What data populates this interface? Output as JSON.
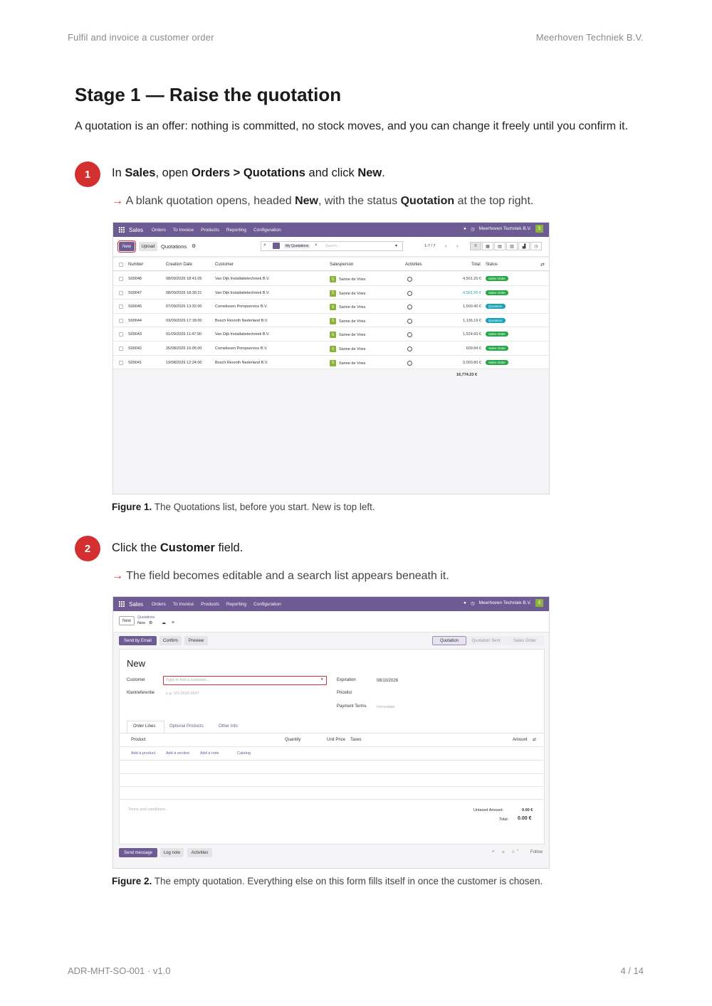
{
  "header": {
    "left": "Fulfil and invoice a customer order",
    "right": "Meerhoven Techniek B.V."
  },
  "title": "Stage 1 — Raise the quotation",
  "intro": "A quotation is an offer: nothing is committed, no stock moves, and you can change it freely until you confirm it.",
  "steps": [
    {
      "number": "1",
      "text_parts": [
        "In ",
        "Sales",
        ", open ",
        "Orders > Quotations",
        " and click ",
        "New",
        "."
      ],
      "result_parts": [
        "A blank quotation opens, headed ",
        "New",
        ", with the status ",
        "Quotation",
        " at the top right."
      ],
      "caption_label": "Figure 1.",
      "caption_text": "The Quotations list, before you start. New is top left."
    },
    {
      "number": "2",
      "text_parts": [
        "Click the ",
        "Customer",
        " field."
      ],
      "result_parts": [
        "The field becomes editable and a search list appears beneath it."
      ],
      "caption_label": "Figure 2.",
      "caption_text": "The empty quotation. Everything else on this form fills itself in once the customer is chosen."
    }
  ],
  "arrow": "→",
  "app": {
    "name": "Sales",
    "menu": [
      "Orders",
      "To Invoice",
      "Products",
      "Reporting",
      "Configuration"
    ],
    "company": "Meerhoven Techniek B.V.",
    "avatar": "S"
  },
  "list_view": {
    "new_button": "New",
    "upload_button": "Upload",
    "breadcrumb": "Quotations",
    "filter_tag": "My Quotations",
    "search_placeholder": "Search...",
    "pager": "1-7 / 7",
    "columns": [
      "Number",
      "Creation Date",
      "Customer",
      "Salesperson",
      "Activities",
      "Total",
      "Status"
    ],
    "rows": [
      {
        "number": "S00048",
        "date": "08/09/2026 18:41:05",
        "customer": "Van Dijk Installatietechniek B.V.",
        "salesperson": "Sanne de Vries",
        "total": "4,501.20 €",
        "status": "Sales Order",
        "status_color": "#28a745",
        "total_color": "#444444"
      },
      {
        "number": "S00047",
        "date": "08/09/2026 18:39:21",
        "customer": "Van Dijk Installatietechniek B.V.",
        "salesperson": "Sanne de Vries",
        "total": "4,501.20 €",
        "status": "Sales Order",
        "status_color": "#28a745",
        "total_color": "#17a2b8"
      },
      {
        "number": "S00045",
        "date": "07/09/2026 13:32:00",
        "customer": "Cornelissen Pompservice B.V.",
        "salesperson": "Sanne de Vries",
        "total": "1,500.40 €",
        "status": "Quotation",
        "status_color": "#17a2b8",
        "total_color": "#444444"
      },
      {
        "number": "S00044",
        "date": "03/09/2026 17:18:00",
        "customer": "Bosch Rexroth Nederland B.V.",
        "salesperson": "Sanne de Vries",
        "total": "1,136.19 €",
        "status": "Quotation",
        "status_color": "#17a2b8",
        "total_color": "#444444"
      },
      {
        "number": "S00043",
        "date": "01/09/2026 11:47:00",
        "customer": "Van Dijk Installatietechniek B.V.",
        "salesperson": "Sanne de Vries",
        "total": "1,524.60 €",
        "status": "Sales Order",
        "status_color": "#28a745",
        "total_color": "#444444"
      },
      {
        "number": "S00042",
        "date": "26/08/2026 16:05:00",
        "customer": "Cornelissen Pompservice B.V.",
        "salesperson": "Sanne de Vries",
        "total": "609.84 €",
        "status": "Sales Order",
        "status_color": "#28a745",
        "total_color": "#444444"
      },
      {
        "number": "S00041",
        "date": "19/08/2026 12:24:00",
        "customer": "Bosch Rexroth Nederland B.V.",
        "salesperson": "Sanne de Vries",
        "total": "3,000.80 €",
        "status": "Sales Order",
        "status_color": "#28a745",
        "total_color": "#444444"
      }
    ],
    "sum": "16,774.23 €"
  },
  "form_view": {
    "new_button": "New",
    "breadcrumb_parent": "Quotations",
    "breadcrumb_current": "New",
    "actions": [
      "Send by Email",
      "Confirm",
      "Preview"
    ],
    "stages": [
      "Quotation",
      "Quotation Sent",
      "Sales Order"
    ],
    "heading": "New",
    "customer_label": "Customer",
    "customer_placeholder": "Type to find a customer...",
    "ref_label": "Klantreferentie",
    "ref_placeholder": "e.g. VO-2026-0537",
    "expiration_label": "Expiration",
    "expiration_value": "08/10/2026",
    "pricelist_label": "Pricelist",
    "terms_label": "Payment Terms",
    "terms_placeholder": "Immediate",
    "tabs": [
      "Order Lines",
      "Optional Products",
      "Other Info"
    ],
    "line_columns": [
      "Product",
      "Quantity",
      "Unit Price",
      "Taxes",
      "Amount"
    ],
    "line_actions": [
      "Add a product",
      "Add a section",
      "Add a note",
      "Catalog"
    ],
    "terms_conditions": "Terms and conditions...",
    "untaxed_label": "Untaxed Amount:",
    "untaxed_value": "0.00 €",
    "total_label": "Total:",
    "total_value": "0.00 €",
    "chatter": [
      "Send message",
      "Log note",
      "Activities"
    ],
    "follow": "Follow",
    "follower_count": "0"
  },
  "footer": {
    "left": "ADR-MHT-SO-001 · v1.0",
    "right": "4 / 14"
  },
  "colors": {
    "accent": "#d32f2f",
    "odoo_purple": "#6f5b94"
  }
}
